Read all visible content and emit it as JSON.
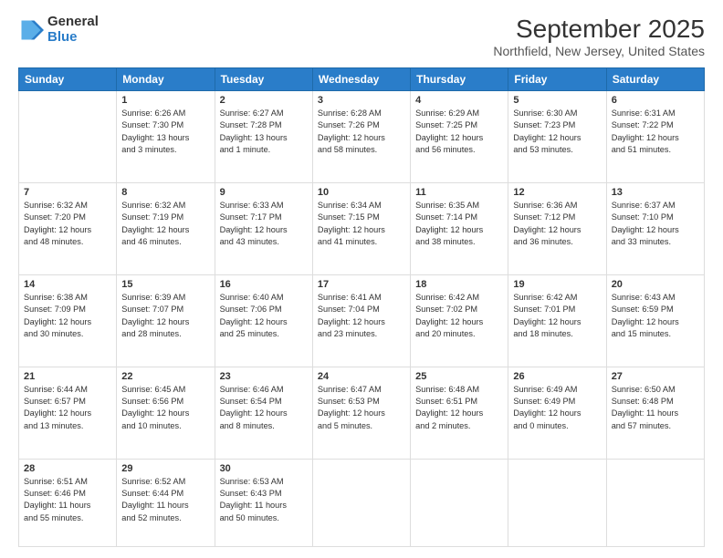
{
  "logo": {
    "general": "General",
    "blue": "Blue"
  },
  "title": "September 2025",
  "location": "Northfield, New Jersey, United States",
  "days": [
    "Sunday",
    "Monday",
    "Tuesday",
    "Wednesday",
    "Thursday",
    "Friday",
    "Saturday"
  ],
  "weeks": [
    [
      {
        "num": "",
        "info": ""
      },
      {
        "num": "1",
        "info": "Sunrise: 6:26 AM\nSunset: 7:30 PM\nDaylight: 13 hours\nand 3 minutes."
      },
      {
        "num": "2",
        "info": "Sunrise: 6:27 AM\nSunset: 7:28 PM\nDaylight: 13 hours\nand 1 minute."
      },
      {
        "num": "3",
        "info": "Sunrise: 6:28 AM\nSunset: 7:26 PM\nDaylight: 12 hours\nand 58 minutes."
      },
      {
        "num": "4",
        "info": "Sunrise: 6:29 AM\nSunset: 7:25 PM\nDaylight: 12 hours\nand 56 minutes."
      },
      {
        "num": "5",
        "info": "Sunrise: 6:30 AM\nSunset: 7:23 PM\nDaylight: 12 hours\nand 53 minutes."
      },
      {
        "num": "6",
        "info": "Sunrise: 6:31 AM\nSunset: 7:22 PM\nDaylight: 12 hours\nand 51 minutes."
      }
    ],
    [
      {
        "num": "7",
        "info": "Sunrise: 6:32 AM\nSunset: 7:20 PM\nDaylight: 12 hours\nand 48 minutes."
      },
      {
        "num": "8",
        "info": "Sunrise: 6:32 AM\nSunset: 7:19 PM\nDaylight: 12 hours\nand 46 minutes."
      },
      {
        "num": "9",
        "info": "Sunrise: 6:33 AM\nSunset: 7:17 PM\nDaylight: 12 hours\nand 43 minutes."
      },
      {
        "num": "10",
        "info": "Sunrise: 6:34 AM\nSunset: 7:15 PM\nDaylight: 12 hours\nand 41 minutes."
      },
      {
        "num": "11",
        "info": "Sunrise: 6:35 AM\nSunset: 7:14 PM\nDaylight: 12 hours\nand 38 minutes."
      },
      {
        "num": "12",
        "info": "Sunrise: 6:36 AM\nSunset: 7:12 PM\nDaylight: 12 hours\nand 36 minutes."
      },
      {
        "num": "13",
        "info": "Sunrise: 6:37 AM\nSunset: 7:10 PM\nDaylight: 12 hours\nand 33 minutes."
      }
    ],
    [
      {
        "num": "14",
        "info": "Sunrise: 6:38 AM\nSunset: 7:09 PM\nDaylight: 12 hours\nand 30 minutes."
      },
      {
        "num": "15",
        "info": "Sunrise: 6:39 AM\nSunset: 7:07 PM\nDaylight: 12 hours\nand 28 minutes."
      },
      {
        "num": "16",
        "info": "Sunrise: 6:40 AM\nSunset: 7:06 PM\nDaylight: 12 hours\nand 25 minutes."
      },
      {
        "num": "17",
        "info": "Sunrise: 6:41 AM\nSunset: 7:04 PM\nDaylight: 12 hours\nand 23 minutes."
      },
      {
        "num": "18",
        "info": "Sunrise: 6:42 AM\nSunset: 7:02 PM\nDaylight: 12 hours\nand 20 minutes."
      },
      {
        "num": "19",
        "info": "Sunrise: 6:42 AM\nSunset: 7:01 PM\nDaylight: 12 hours\nand 18 minutes."
      },
      {
        "num": "20",
        "info": "Sunrise: 6:43 AM\nSunset: 6:59 PM\nDaylight: 12 hours\nand 15 minutes."
      }
    ],
    [
      {
        "num": "21",
        "info": "Sunrise: 6:44 AM\nSunset: 6:57 PM\nDaylight: 12 hours\nand 13 minutes."
      },
      {
        "num": "22",
        "info": "Sunrise: 6:45 AM\nSunset: 6:56 PM\nDaylight: 12 hours\nand 10 minutes."
      },
      {
        "num": "23",
        "info": "Sunrise: 6:46 AM\nSunset: 6:54 PM\nDaylight: 12 hours\nand 8 minutes."
      },
      {
        "num": "24",
        "info": "Sunrise: 6:47 AM\nSunset: 6:53 PM\nDaylight: 12 hours\nand 5 minutes."
      },
      {
        "num": "25",
        "info": "Sunrise: 6:48 AM\nSunset: 6:51 PM\nDaylight: 12 hours\nand 2 minutes."
      },
      {
        "num": "26",
        "info": "Sunrise: 6:49 AM\nSunset: 6:49 PM\nDaylight: 12 hours\nand 0 minutes."
      },
      {
        "num": "27",
        "info": "Sunrise: 6:50 AM\nSunset: 6:48 PM\nDaylight: 11 hours\nand 57 minutes."
      }
    ],
    [
      {
        "num": "28",
        "info": "Sunrise: 6:51 AM\nSunset: 6:46 PM\nDaylight: 11 hours\nand 55 minutes."
      },
      {
        "num": "29",
        "info": "Sunrise: 6:52 AM\nSunset: 6:44 PM\nDaylight: 11 hours\nand 52 minutes."
      },
      {
        "num": "30",
        "info": "Sunrise: 6:53 AM\nSunset: 6:43 PM\nDaylight: 11 hours\nand 50 minutes."
      },
      {
        "num": "",
        "info": ""
      },
      {
        "num": "",
        "info": ""
      },
      {
        "num": "",
        "info": ""
      },
      {
        "num": "",
        "info": ""
      }
    ]
  ]
}
